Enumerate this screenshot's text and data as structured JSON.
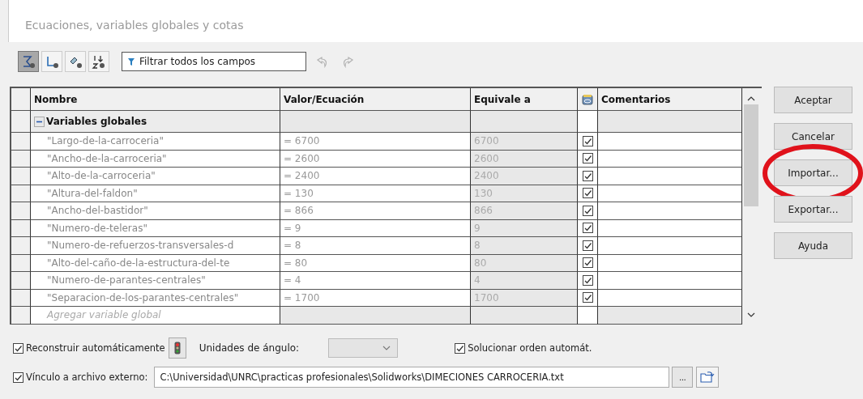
{
  "window": {
    "title": "Ecuaciones, variables globales y cotas"
  },
  "toolbar": {
    "view_buttons": [
      {
        "kind": "equations",
        "selected": true
      },
      {
        "kind": "dimensions",
        "selected": false
      },
      {
        "kind": "features",
        "selected": false
      },
      {
        "kind": "order",
        "selected": false
      }
    ],
    "filter": {
      "placeholder": "Filtrar todos los campos"
    },
    "undo": {
      "disabled": true
    },
    "redo": {
      "disabled": true
    }
  },
  "table": {
    "columns": [
      "Nombre",
      "Valor/Ecuación",
      "Equivale a",
      "Comentarios"
    ],
    "group": {
      "label": "Variables globales",
      "expanded": true
    },
    "rows": [
      {
        "name": "\"Largo-de-la-carroceria\"",
        "value": "= 6700",
        "equals": "6700",
        "checked": true
      },
      {
        "name": "\"Ancho-de-la-carroceria\"",
        "value": "= 2600",
        "equals": "2600",
        "checked": true
      },
      {
        "name": "\"Alto-de-la-carroceria\"",
        "value": "= 2400",
        "equals": "2400",
        "checked": true
      },
      {
        "name": "\"Altura-del-faldon\"",
        "value": "= 130",
        "equals": "130",
        "checked": true
      },
      {
        "name": "\"Ancho-del-bastidor\"",
        "value": "= 866",
        "equals": "866",
        "checked": true
      },
      {
        "name": "\"Numero-de-teleras\"",
        "value": "= 9",
        "equals": "9",
        "checked": true
      },
      {
        "name": "\"Numero-de-refuerzos-transversales-d",
        "value": "= 8",
        "equals": "8",
        "checked": true
      },
      {
        "name": "\"Alto-del-caño-de-la-estructura-del-te",
        "value": "= 80",
        "equals": "80",
        "checked": true
      },
      {
        "name": "\"Numero-de-parantes-centrales\"",
        "value": "= 4",
        "equals": "4",
        "checked": true
      },
      {
        "name": "\"Separacion-de-los-parantes-centrales\"",
        "value": "= 1700",
        "equals": "1700",
        "checked": true
      }
    ],
    "add_row": {
      "placeholder": "Agregar variable global"
    }
  },
  "buttons": [
    {
      "label": "Aceptar",
      "highlighted": false
    },
    {
      "label": "Cancelar",
      "highlighted": false
    },
    {
      "label": "Importar...",
      "highlighted": true
    },
    {
      "label": "Exportar...",
      "highlighted": false
    },
    {
      "label": "Ayuda",
      "highlighted": false
    }
  ],
  "options": {
    "rebuild": {
      "label": "Reconstruir automáticamente",
      "checked": true
    },
    "angle_units": {
      "label": "Unidades de ángulo:",
      "disabled": true
    },
    "solve_order": {
      "label": "Solucionar orden automát.",
      "checked": true
    },
    "external_link": {
      "label": "Vínculo a archivo externo:",
      "checked": true,
      "path": "C:\\Universidad\\UNRC\\practicas profesionales\\Solidworks\\DIMECIONES CARROCERIA.txt"
    },
    "browse": {
      "label": "..."
    }
  }
}
